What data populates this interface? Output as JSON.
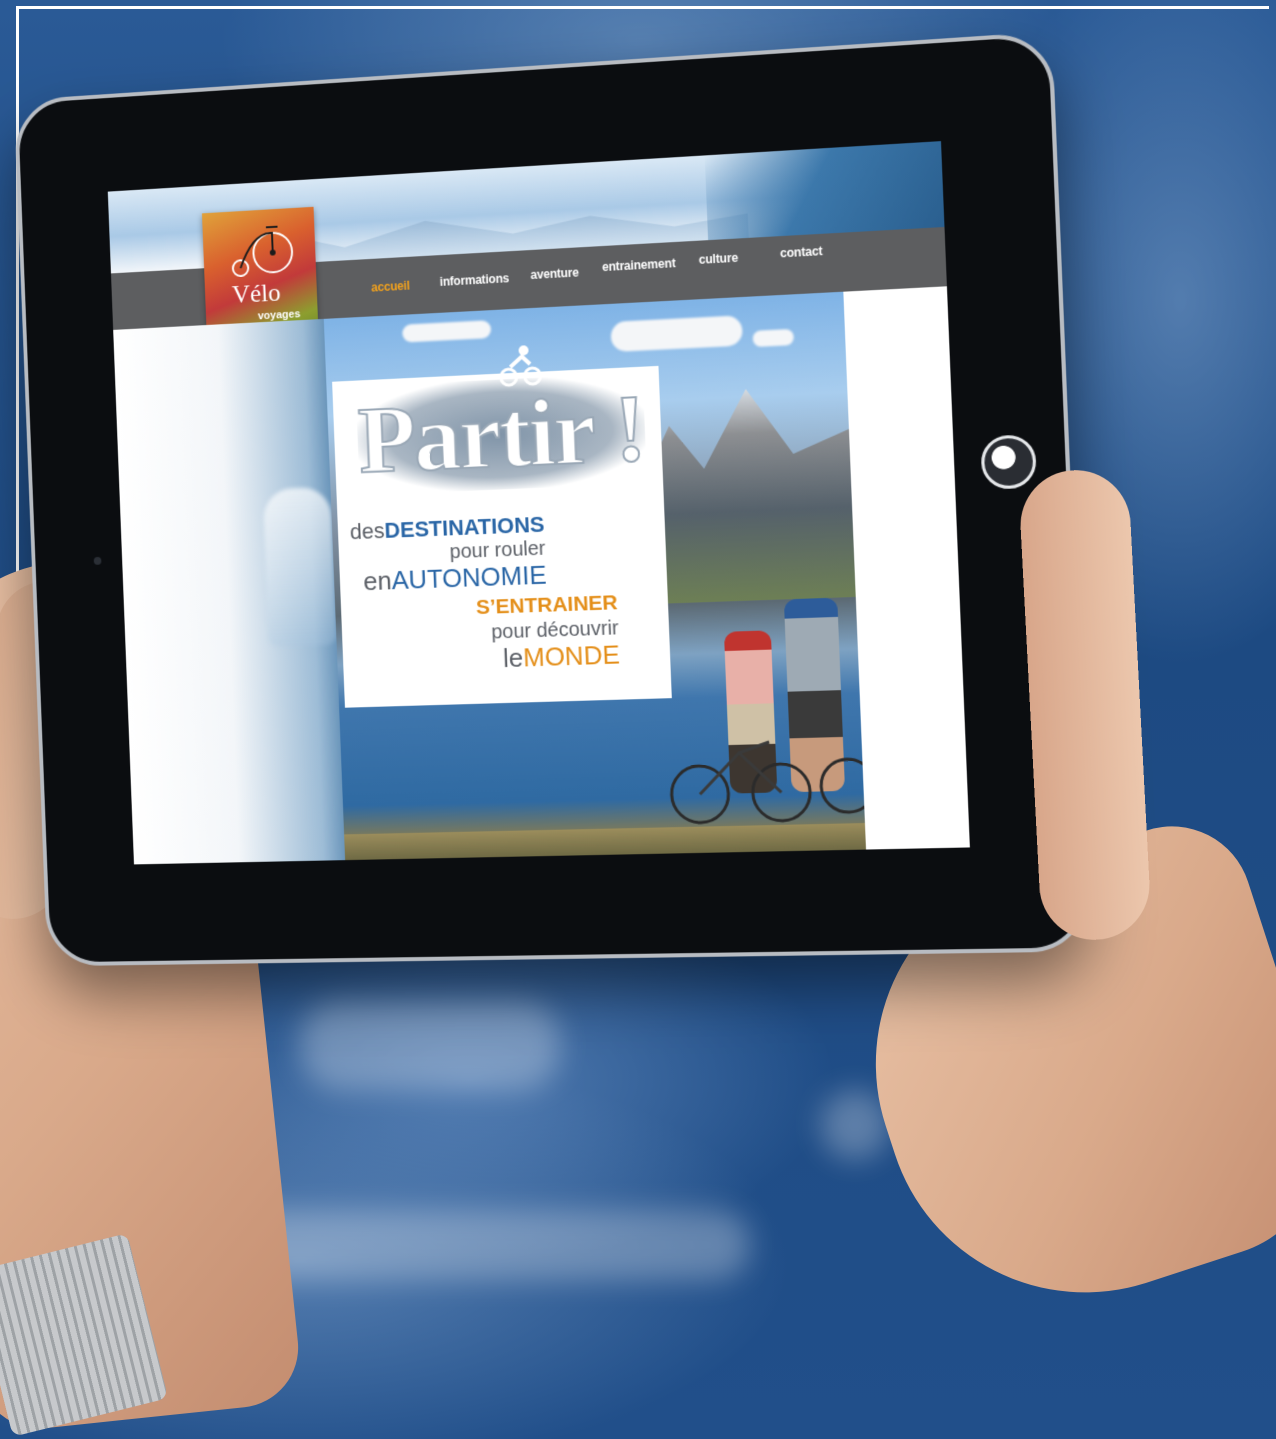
{
  "site": {
    "logo": {
      "title": "Vélo",
      "subtitle": "voyages"
    },
    "nav": [
      {
        "label": "accueil",
        "active": true
      },
      {
        "label": "informations",
        "active": false
      },
      {
        "label": "aventure",
        "active": false
      },
      {
        "label": "entrainement",
        "active": false
      },
      {
        "label": "culture",
        "active": false
      },
      {
        "label": "contact",
        "active": false
      }
    ],
    "hero": {
      "headline": "Partir !",
      "lines": [
        {
          "prefix": "des",
          "emphasis": "DESTINATIONS"
        },
        {
          "text": "pour rouler"
        },
        {
          "prefix": "en",
          "emphasis": "AUTONOMIE"
        },
        {
          "emphasis": "S’ENTRAINER"
        },
        {
          "text": "pour découvrir"
        },
        {
          "prefix": "le",
          "emphasis": "MONDE"
        }
      ]
    }
  },
  "colors": {
    "accent_orange": "#f3a21c",
    "brand_blue": "#2a66a6",
    "nav_bar": "#5d5e60",
    "background_blue": "#1f4e86"
  },
  "icons": [
    "penny-farthing-bicycle-icon",
    "cyclist-icon",
    "home-button-icon"
  ]
}
